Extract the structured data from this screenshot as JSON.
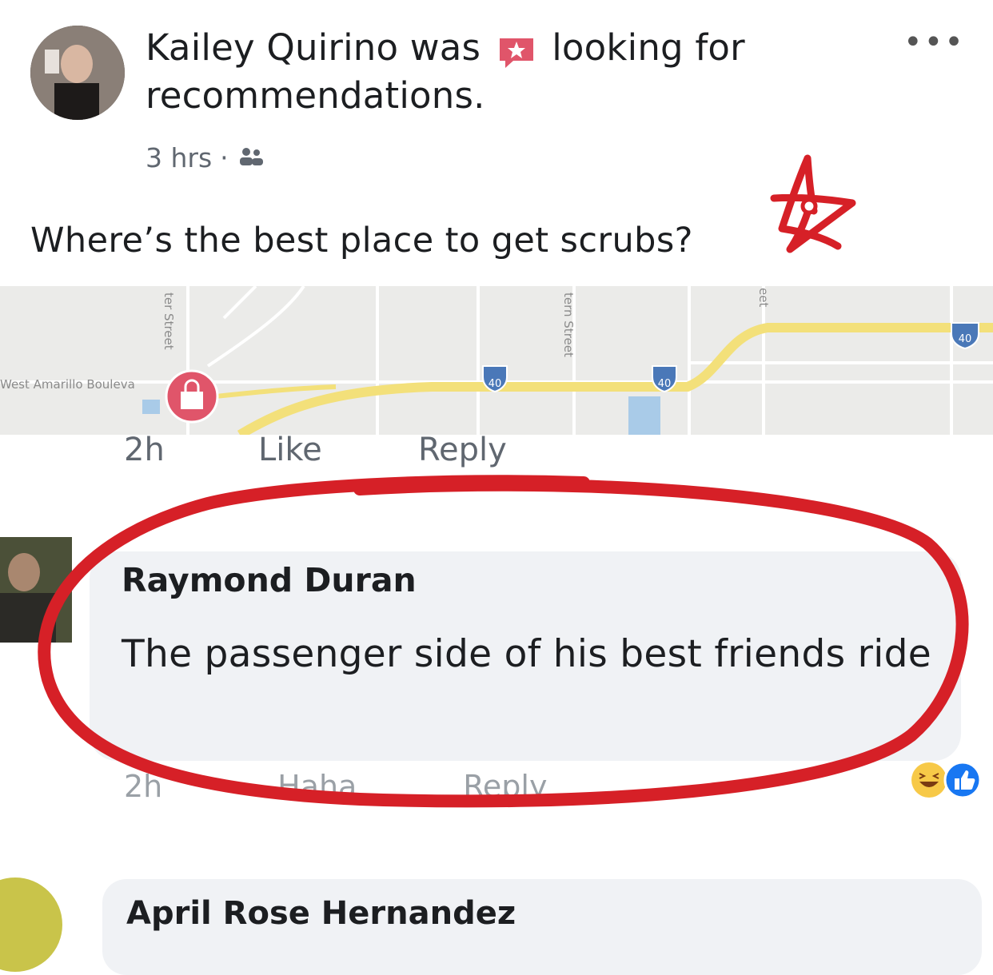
{
  "post": {
    "author": "Kailey Quirino",
    "activity_pre": "was",
    "activity_icon": "recommendation-icon",
    "activity_post": "looking for recommendations.",
    "time": "3 hrs",
    "audience_icon": "friends-icon",
    "text": "Where’s the best place to get scrubs?",
    "more_icon": "more-options-icon"
  },
  "map": {
    "labels": [
      "ter Street",
      "tern Street",
      "eet",
      "West Amarillo Bouleva"
    ],
    "highway_shield": "40",
    "pin_icon": "shopping-bag-pin-icon"
  },
  "first_actions": {
    "time": "2h",
    "like": "Like",
    "reply": "Reply"
  },
  "comment": {
    "author": "Raymond Duran",
    "text": "The passenger side of his best friends ride",
    "time": "2h",
    "action": "Haha",
    "reply": "Reply",
    "reactions": [
      "haha-reaction-icon",
      "like-reaction-icon"
    ]
  },
  "next_comment": {
    "author": "April Rose Hernandez"
  },
  "colors": {
    "annotation_red": "#d62027",
    "map_road_yellow": "#f3e07a",
    "highway_blue": "#4a78b8",
    "bubble_gray": "#f0f2f5"
  }
}
